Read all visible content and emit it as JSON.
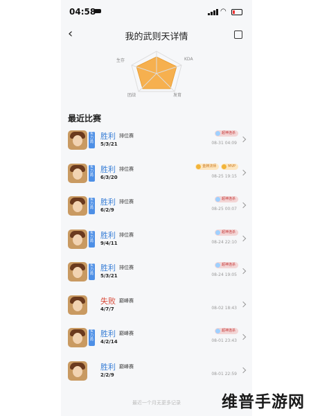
{
  "status_bar": {
    "time": "04:58"
  },
  "header": {
    "title": "我的武则天详情"
  },
  "radar": {
    "labels": {
      "top_left": "生存",
      "top_right": "KDA",
      "bottom_left": "团战",
      "bottom_right": "发育"
    }
  },
  "section": {
    "title": "最近比赛"
  },
  "matches": [
    {
      "result": "胜利",
      "mode": "排位赛",
      "kda": "5/3/21",
      "badges": [
        "超神连杀"
      ],
      "badge_gold": false,
      "time": "08-31 04:09",
      "tag": "实力局"
    },
    {
      "result": "胜利",
      "mode": "排位赛",
      "kda": "6/3/20",
      "badges": [
        "金牌法师",
        "MVP"
      ],
      "badge_gold": true,
      "time": "08-25 19:15",
      "tag": "实力局"
    },
    {
      "result": "胜利",
      "mode": "排位赛",
      "kda": "6/2/9",
      "badges": [
        "超神连杀"
      ],
      "badge_gold": false,
      "time": "08-25 00:07",
      "tag": "实力局"
    },
    {
      "result": "胜利",
      "mode": "排位赛",
      "kda": "9/4/11",
      "badges": [
        "超神连杀"
      ],
      "badge_gold": false,
      "time": "08-24 22:10",
      "tag": "实力局"
    },
    {
      "result": "胜利",
      "mode": "排位赛",
      "kda": "5/3/21",
      "badges": [
        "超神连杀"
      ],
      "badge_gold": false,
      "time": "08-24 19:05",
      "tag": "实力局"
    },
    {
      "result": "失败",
      "mode": "巅峰赛",
      "kda": "4/7/7",
      "badges": [],
      "badge_gold": false,
      "time": "08-02 18:43",
      "tag": ""
    },
    {
      "result": "胜利",
      "mode": "巅峰赛",
      "kda": "4/2/14",
      "badges": [
        "超神连杀"
      ],
      "badge_gold": false,
      "time": "08-01 23:43",
      "tag": "实力局"
    },
    {
      "result": "胜利",
      "mode": "巅峰赛",
      "kda": "2/2/9",
      "badges": [],
      "badge_gold": false,
      "time": "08-01 22:59",
      "tag": ""
    }
  ],
  "footer": {
    "text": "最近一个月无更多记录"
  },
  "watermark": {
    "text": "维普手游网"
  },
  "colors": {
    "win": "#3a7fd6",
    "loss": "#d94b3a",
    "radar_fill": "#f6b04f"
  }
}
